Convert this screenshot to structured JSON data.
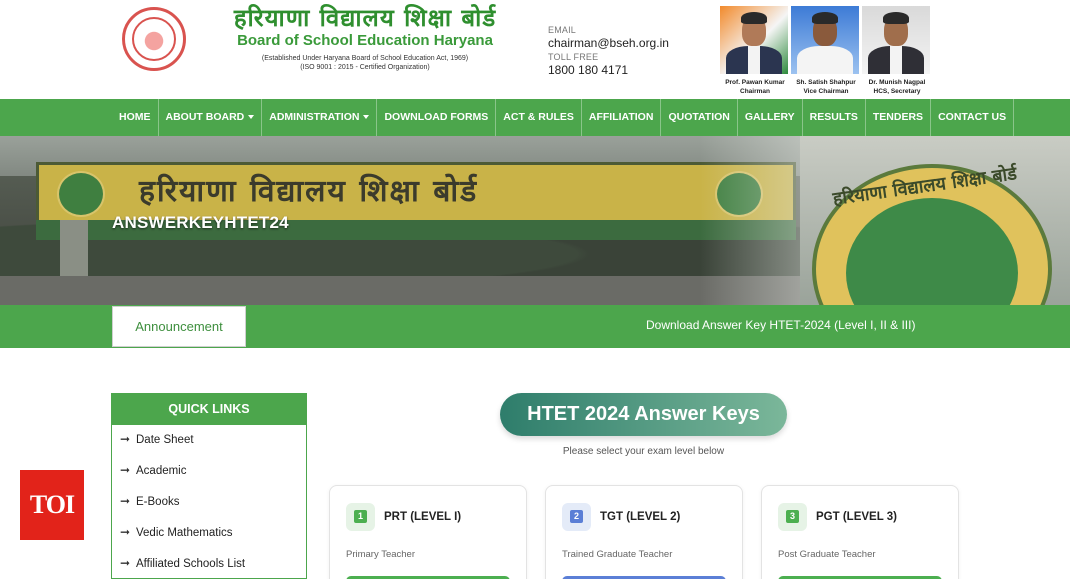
{
  "header": {
    "title_hindi": "हरियाणा विद्यालय शिक्षा बोर्ड",
    "title_en": "Board of School Education Haryana",
    "subtitle_line1": "(Established Under Haryana Board of School Education Act, 1969)",
    "subtitle_line2": "(ISO 9001 : 2015 - Certified Organization)",
    "email_label": "EMAIL",
    "email": "chairman@bseh.org.in",
    "tollfree_label": "TOLL FREE",
    "tollfree": "1800 180 4171",
    "officials": [
      {
        "name": "Prof. Pawan Kumar",
        "role": "Chairman"
      },
      {
        "name": "Sh. Satish Shahpur",
        "role": "Vice Chairman"
      },
      {
        "name": "Dr. Munish Nagpal",
        "role": "HCS, Secretary"
      }
    ]
  },
  "nav": {
    "items": [
      {
        "label": "HOME",
        "dropdown": false
      },
      {
        "label": "ABOUT BOARD",
        "dropdown": true
      },
      {
        "label": "ADMINISTRATION",
        "dropdown": true
      },
      {
        "label": "DOWNLOAD FORMS",
        "dropdown": false
      },
      {
        "label": "ACT & RULES",
        "dropdown": false
      },
      {
        "label": "AFFILIATION",
        "dropdown": false
      },
      {
        "label": "QUOTATION",
        "dropdown": false
      },
      {
        "label": "GALLERY",
        "dropdown": false
      },
      {
        "label": "RESULTS",
        "dropdown": false
      },
      {
        "label": "TENDERS",
        "dropdown": false
      },
      {
        "label": "CONTACT US",
        "dropdown": false
      }
    ]
  },
  "banner": {
    "page_title": "ANSWERKEYHTET24",
    "gate_text": "हरियाणा विद्यालय शिक्षा बोर्ड",
    "seal_text": "हरियाणा विद्यालय शिक्षा बोर्ड"
  },
  "announcement": {
    "tab_label": "Announcement",
    "ticker": "Download Answer Key HTET-2024 (Level I, II & III)"
  },
  "quick_links": {
    "heading": "QUICK LINKS",
    "items": [
      "Date Sheet",
      "Academic",
      "E-Books",
      "Vedic Mathematics",
      "Affiliated Schools List"
    ]
  },
  "badge": {
    "label": "TOI"
  },
  "main": {
    "heading": "HTET 2024 Answer Keys",
    "instruction": "Please select your exam level below",
    "cards": [
      {
        "number": "1",
        "level": "PRT (LEVEL I)",
        "desc": "Primary Teacher",
        "accent": "#4caf50",
        "tint": "#e6f3e6"
      },
      {
        "number": "2",
        "level": "TGT (LEVEL 2)",
        "desc": "Trained Graduate Teacher",
        "accent": "#5b7fd6",
        "tint": "#e4ebf8"
      },
      {
        "number": "3",
        "level": "PGT (LEVEL 3)",
        "desc": "Post Graduate Teacher",
        "accent": "#4caf50",
        "tint": "#e6f3e6"
      }
    ]
  },
  "colors": {
    "primary_green": "#4ca64c",
    "toi_red": "#e2231a"
  }
}
